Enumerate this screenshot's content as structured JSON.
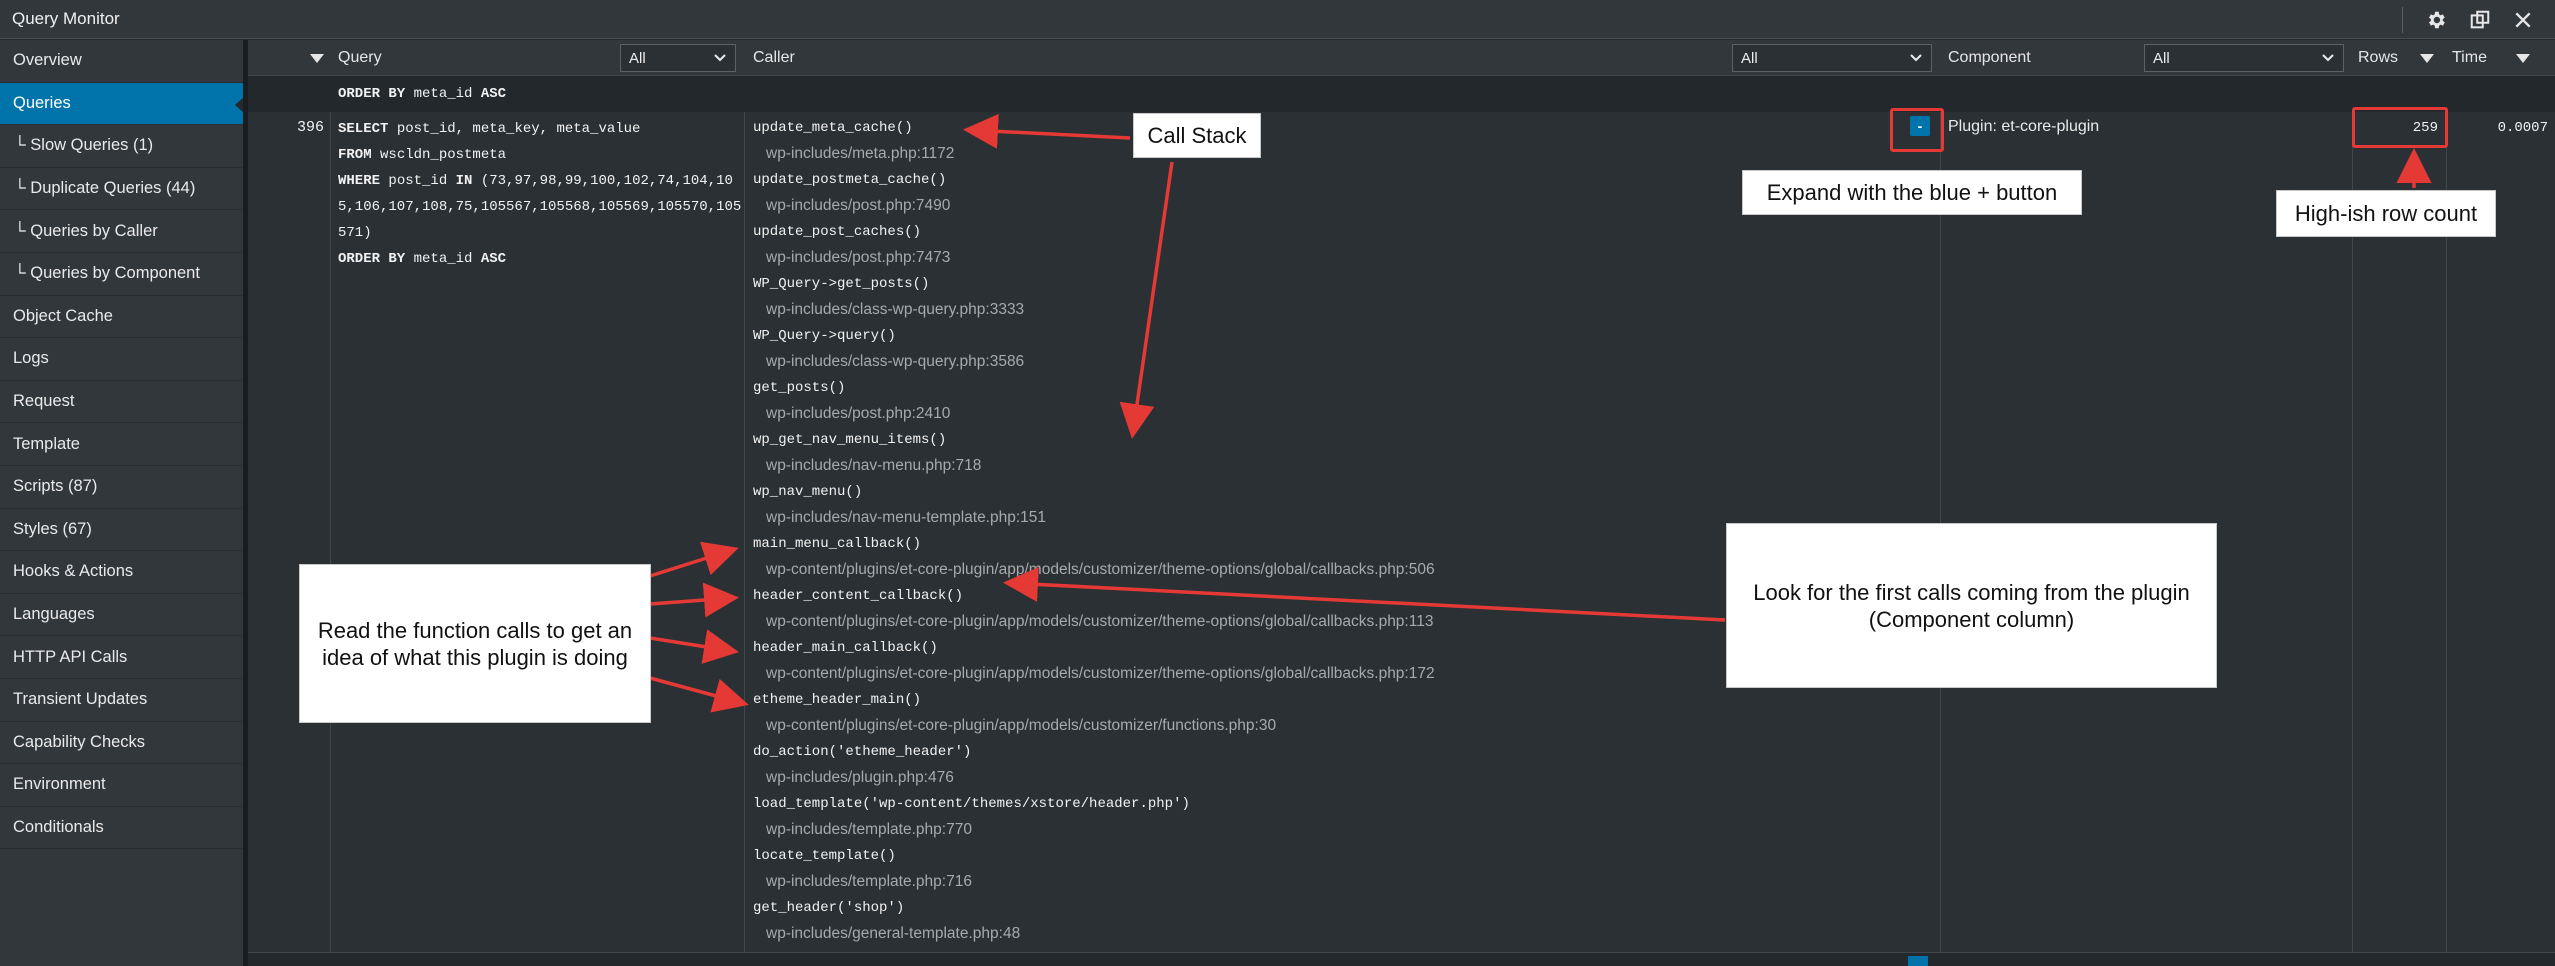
{
  "window": {
    "title": "Query Monitor"
  },
  "icons": {
    "settings": "gear-icon",
    "popout": "popout-icon",
    "close": "close-icon"
  },
  "colors": {
    "accent": "#0073aa",
    "annotation_red": "#e53935",
    "background": "#23282d",
    "sidebar": "#32373c"
  },
  "sidebar": {
    "items": [
      {
        "label": "Overview"
      },
      {
        "label": "Queries",
        "active": true
      },
      {
        "label": "└ Slow Queries (1)"
      },
      {
        "label": "└ Duplicate Queries (44)"
      },
      {
        "label": "└ Queries by Caller"
      },
      {
        "label": "└ Queries by Component"
      },
      {
        "label": "Object Cache"
      },
      {
        "label": "Logs"
      },
      {
        "label": "Request"
      },
      {
        "label": "Template"
      },
      {
        "label": "Scripts (87)"
      },
      {
        "label": "Styles (67)"
      },
      {
        "label": "Hooks & Actions"
      },
      {
        "label": "Languages"
      },
      {
        "label": "HTTP API Calls"
      },
      {
        "label": "Transient Updates"
      },
      {
        "label": "Capability Checks"
      },
      {
        "label": "Environment"
      },
      {
        "label": "Conditionals"
      }
    ]
  },
  "table": {
    "headers": {
      "query": "Query",
      "query_filter": "All",
      "caller": "Caller",
      "caller_filter": "All",
      "component": "Component",
      "component_filter": "All",
      "rows": "Rows",
      "time": "Time"
    },
    "prev_row_tail": {
      "kw": "ORDER BY",
      "rest": " meta_id ",
      "kw2": "ASC"
    },
    "row": {
      "number": "396",
      "query_lines": [
        {
          "kw": "SELECT",
          "rest": " post_id, meta_key, meta_value"
        },
        {
          "kw": "FROM",
          "rest": " wscldn_postmeta"
        },
        {
          "kw": "WHERE",
          "rest": " post_id ",
          "kw2": "IN",
          "rest2": " (73,97,98,99,100,102,74,104,10"
        },
        {
          "kw": "",
          "rest": "5,106,107,108,75,105567,105568,105569,105570,105"
        },
        {
          "kw": "",
          "rest": "571)"
        },
        {
          "kw": "ORDER BY",
          "rest": " meta_id ",
          "kw2": "ASC"
        }
      ],
      "callers": [
        {
          "fn": "update_meta_cache()",
          "path": "wp-includes/meta.php:1172"
        },
        {
          "fn": "update_postmeta_cache()",
          "path": "wp-includes/post.php:7490"
        },
        {
          "fn": "update_post_caches()",
          "path": "wp-includes/post.php:7473"
        },
        {
          "fn": "WP_Query->get_posts()",
          "path": "wp-includes/class-wp-query.php:3333"
        },
        {
          "fn": "WP_Query->query()",
          "path": "wp-includes/class-wp-query.php:3586"
        },
        {
          "fn": "get_posts()",
          "path": "wp-includes/post.php:2410"
        },
        {
          "fn": "wp_get_nav_menu_items()",
          "path": "wp-includes/nav-menu.php:718"
        },
        {
          "fn": "wp_nav_menu()",
          "path": "wp-includes/nav-menu-template.php:151"
        },
        {
          "fn": "main_menu_callback()",
          "path": "wp-content/plugins/et-core-plugin/app/models/customizer/theme-options/global/callbacks.php:506"
        },
        {
          "fn": "header_content_callback()",
          "path": "wp-content/plugins/et-core-plugin/app/models/customizer/theme-options/global/callbacks.php:113"
        },
        {
          "fn": "header_main_callback()",
          "path": "wp-content/plugins/et-core-plugin/app/models/customizer/theme-options/global/callbacks.php:172"
        },
        {
          "fn": "etheme_header_main()",
          "path": "wp-content/plugins/et-core-plugin/app/models/customizer/functions.php:30"
        },
        {
          "fn": "do_action('etheme_header')",
          "path": "wp-includes/plugin.php:476"
        },
        {
          "fn": "load_template('wp-content/themes/xstore/header.php')",
          "path": "wp-includes/template.php:770"
        },
        {
          "fn": "locate_template()",
          "path": "wp-includes/template.php:716"
        },
        {
          "fn": "get_header('shop')",
          "path": "wp-includes/general-template.php:48"
        }
      ],
      "expand_button": "-",
      "component": "Plugin: et-core-plugin",
      "rows": "259",
      "time": "0.0007"
    }
  },
  "annotations": {
    "call_stack": "Call Stack",
    "expand": "Expand with the blue + button",
    "row_count": "High-ish row count",
    "read_calls": "Read the function calls to get an idea of what this plugin is doing",
    "first_calls": "Look for the first calls coming from the plugin (Component column)"
  }
}
